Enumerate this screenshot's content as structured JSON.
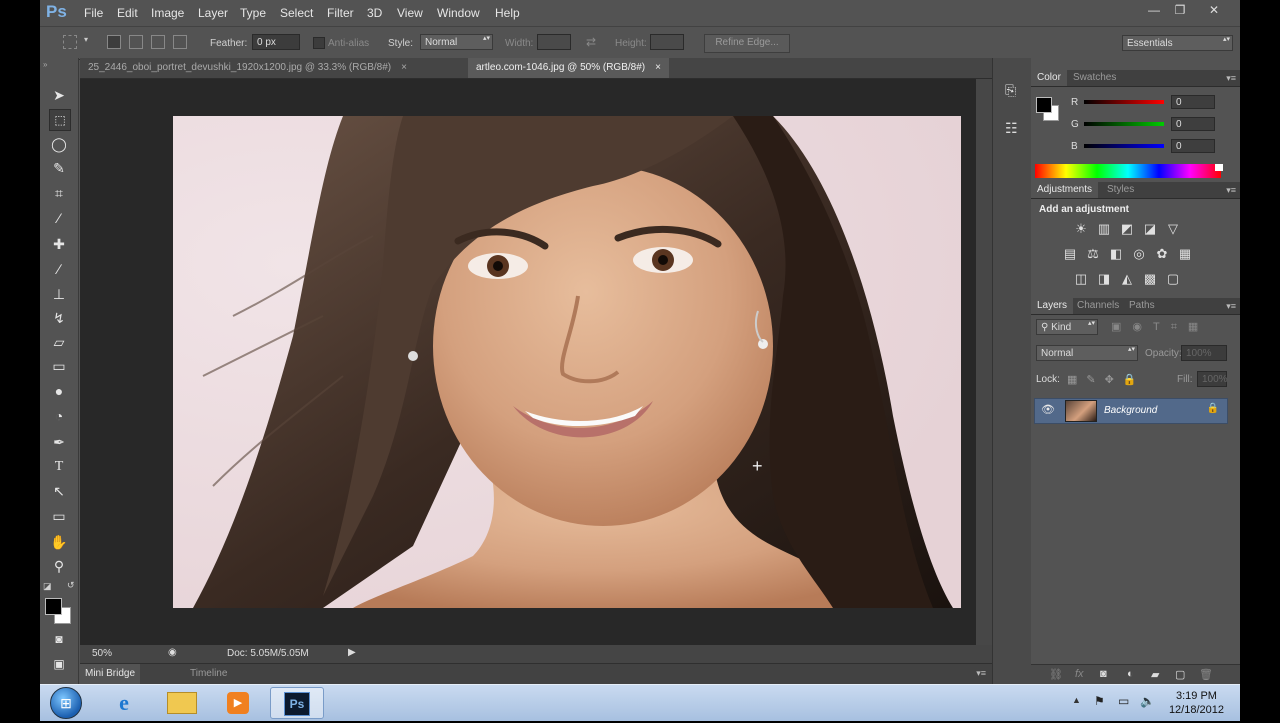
{
  "menubar": {
    "app_logo": "Ps",
    "items": [
      "File",
      "Edit",
      "Image",
      "Layer",
      "Type",
      "Select",
      "Filter",
      "3D",
      "View",
      "Window",
      "Help"
    ],
    "window_controls": {
      "minimize": "—",
      "restore": "❐",
      "close": "✕"
    }
  },
  "options": {
    "feather_label": "Feather:",
    "feather_value": "0 px",
    "antialias_label": "Anti-alias",
    "style_label": "Style:",
    "style_value": "Normal",
    "width_label": "Width:",
    "height_label": "Height:",
    "refine_label": "Refine Edge...",
    "workspace": "Essentials"
  },
  "tools": [
    "move-tool",
    "marquee-tool",
    "lasso-tool",
    "quick-selection-tool",
    "crop-tool",
    "eyedropper-tool",
    "healing-brush-tool",
    "brush-tool",
    "clone-stamp-tool",
    "history-brush-tool",
    "eraser-tool",
    "gradient-tool",
    "blur-tool",
    "dodge-tool",
    "pen-tool",
    "type-tool",
    "path-selection-tool",
    "rectangle-tool",
    "hand-tool",
    "zoom-tool"
  ],
  "document": {
    "tabs": [
      {
        "label": "25_2446_oboi_portret_devushki_1920x1200.jpg @ 33.3% (RGB/8#)",
        "close": "×"
      },
      {
        "label": "artleo.com-1046.jpg @ 50% (RGB/8#)",
        "close": "×"
      }
    ],
    "zoom": "50%",
    "doc_info": "Doc: 5.05M/5.05M",
    "bottom_tabs": [
      "Mini Bridge",
      "Timeline"
    ]
  },
  "color_panel": {
    "tabs": [
      "Color",
      "Swatches"
    ],
    "channels": [
      {
        "label": "R",
        "value": "0"
      },
      {
        "label": "G",
        "value": "0"
      },
      {
        "label": "B",
        "value": "0"
      }
    ]
  },
  "adjustments_panel": {
    "tabs": [
      "Adjustments",
      "Styles"
    ],
    "title": "Add an adjustment"
  },
  "layers_panel": {
    "tabs": [
      "Layers",
      "Channels",
      "Paths"
    ],
    "kind_label": "Kind",
    "blend_mode": "Normal",
    "opacity_label": "Opacity:",
    "opacity_value": "100%",
    "lock_label": "Lock:",
    "fill_label": "Fill:",
    "fill_value": "100%",
    "layers": [
      {
        "name": "Background"
      }
    ]
  },
  "taskbar": {
    "ps_label": "Ps",
    "time": "3:19 PM",
    "date": "12/18/2012"
  },
  "colors": {
    "accent": "#52698a",
    "ui_bg": "#535353",
    "canvas_bg": "#282828"
  }
}
